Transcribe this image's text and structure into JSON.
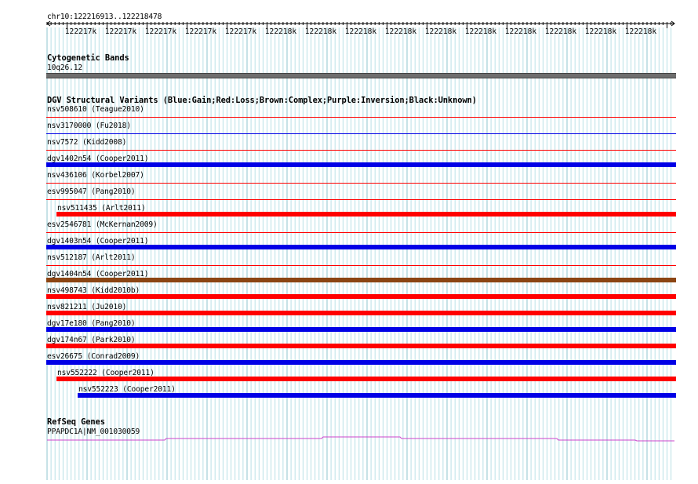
{
  "ruler": {
    "coord_label": "chr10:122216913..122218478",
    "tick_labels": [
      "122217k",
      "122217k",
      "122217k",
      "122217k",
      "122217k",
      "122218k",
      "122218k",
      "122218k",
      "122218k",
      "122218k",
      "122218k",
      "122218k",
      "122218k",
      "122218k",
      "122218k"
    ]
  },
  "cytoband": {
    "title": "Cytogenetic Bands",
    "band": "10q26.12",
    "color": "#6e6e6e"
  },
  "dgv": {
    "title": "DGV Structural Variants (Blue:Gain;Red:Loss;Brown:Complex;Purple:Inversion;Black:Unknown)",
    "colors": {
      "gain": "#0000e6",
      "loss": "#ff0000",
      "complex": "#8b4513"
    },
    "variants": [
      {
        "label": "nsv508610 (Teague2010)",
        "kind": "loss",
        "style": "thin",
        "indent": 0
      },
      {
        "label": "nsv3170000 (Fu2018)",
        "kind": "gain",
        "style": "thin",
        "indent": 0
      },
      {
        "label": "nsv7572 (Kidd2008)",
        "kind": "loss",
        "style": "thin",
        "indent": 0
      },
      {
        "label": "dgv1402n54 (Cooper2011)",
        "kind": "gain",
        "style": "thick",
        "indent": 0
      },
      {
        "label": "nsv436106 (Korbel2007)",
        "kind": "loss",
        "style": "thin",
        "indent": 0
      },
      {
        "label": "esv995047 (Pang2010)",
        "kind": "loss",
        "style": "thin",
        "indent": 0
      },
      {
        "label": "nsv511435 (Arlt2011)",
        "kind": "loss",
        "style": "thick",
        "indent": 1
      },
      {
        "label": "esv2546781 (McKernan2009)",
        "kind": "loss",
        "style": "thin",
        "indent": 0
      },
      {
        "label": "dgv1403n54 (Cooper2011)",
        "kind": "gain",
        "style": "thick",
        "indent": 0
      },
      {
        "label": "nsv512187 (Arlt2011)",
        "kind": "loss",
        "style": "thin",
        "indent": 0
      },
      {
        "label": "dgv1404n54 (Cooper2011)",
        "kind": "complex",
        "style": "thick",
        "indent": 0
      },
      {
        "label": "nsv498743 (Kidd2010b)",
        "kind": "loss",
        "style": "thick",
        "indent": 0
      },
      {
        "label": "nsv821211 (Ju2010)",
        "kind": "loss",
        "style": "thick",
        "indent": 0
      },
      {
        "label": "dgv17e180 (Pang2010)",
        "kind": "gain",
        "style": "thick",
        "indent": 0
      },
      {
        "label": "dgv174n67 (Park2010)",
        "kind": "loss",
        "style": "thick",
        "indent": 0
      },
      {
        "label": "esv26675 (Conrad2009)",
        "kind": "gain",
        "style": "thick",
        "indent": 0
      },
      {
        "label": "nsv552222 (Cooper2011)",
        "kind": "loss",
        "style": "thick",
        "indent": 2
      },
      {
        "label": "nsv552223 (Cooper2011)",
        "kind": "gain",
        "style": "thick",
        "indent": 3
      }
    ]
  },
  "refseq": {
    "title": "RefSeq Genes",
    "gene_label": "PPAPDC1A|NM_001030059",
    "color": "#cc44cc"
  }
}
